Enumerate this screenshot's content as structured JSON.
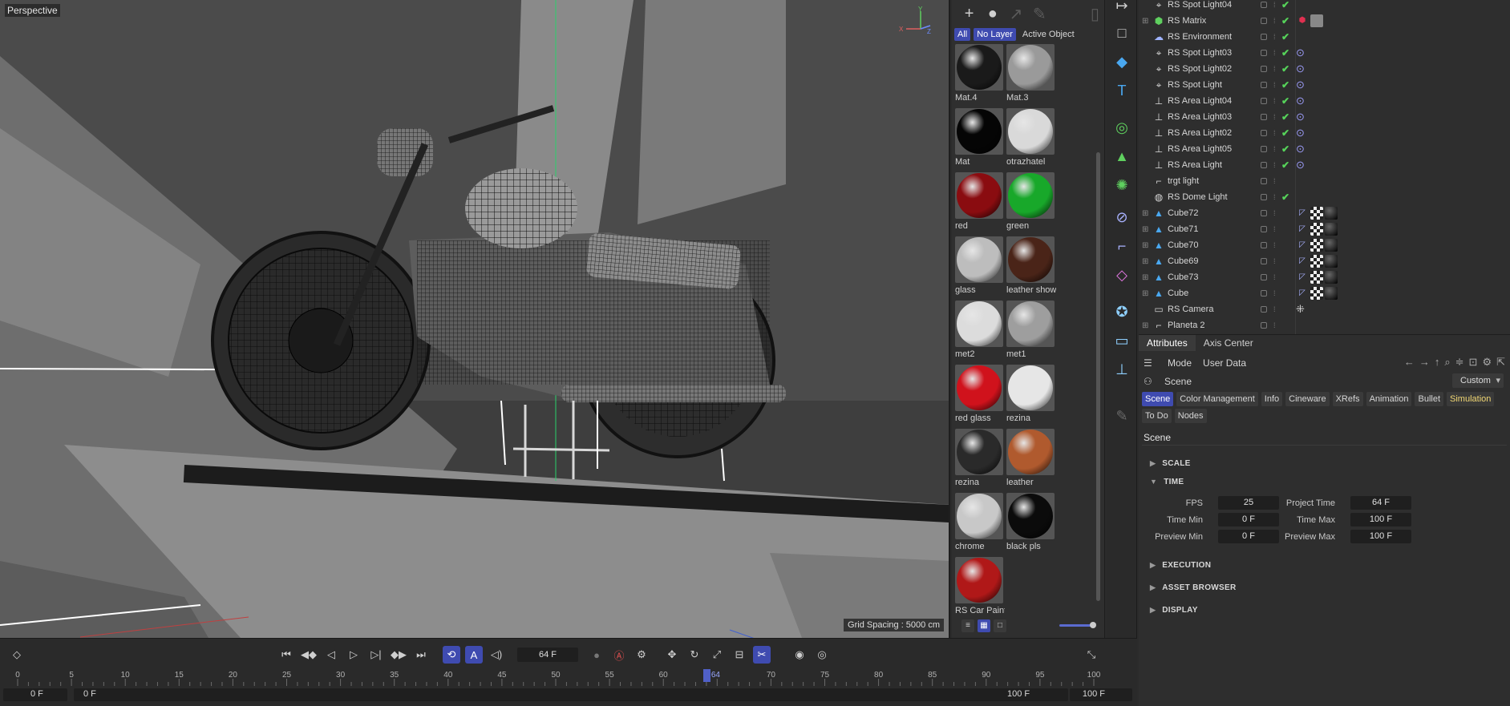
{
  "viewport": {
    "title": "Perspective",
    "grid_spacing": "Grid Spacing : 5000 cm",
    "axes": {
      "x": "X",
      "y": "Y",
      "z": "Z"
    }
  },
  "material_manager": {
    "filters": [
      {
        "label": "All",
        "active": true
      },
      {
        "label": "No Layer",
        "active": true
      },
      {
        "label": "Active Object",
        "active": false
      }
    ],
    "materials": [
      {
        "name": "Mat.4",
        "color": "#1a1a1a"
      },
      {
        "name": "Mat.3",
        "color": "#9a9a9a"
      },
      {
        "name": "Mat",
        "color": "#050505"
      },
      {
        "name": "otrazhatel",
        "color": "#d9d9d9"
      },
      {
        "name": "red",
        "color": "#8a0c10"
      },
      {
        "name": "green",
        "color": "#18a82a"
      },
      {
        "name": "glass",
        "color": "#bdbdbd"
      },
      {
        "name": "leather show",
        "color": "#4a2418"
      },
      {
        "name": "met2",
        "color": "#dcdcdc"
      },
      {
        "name": "met1",
        "color": "#9e9e9e"
      },
      {
        "name": "red glass",
        "color": "#d0121c"
      },
      {
        "name": "rezina",
        "color": "#e6e6e6"
      },
      {
        "name": "rezina",
        "color": "#2a2a2a"
      },
      {
        "name": "leather",
        "color": "#b05a2e"
      },
      {
        "name": "chrome",
        "color": "#c8c8c8"
      },
      {
        "name": "black pls",
        "color": "#0b0b0b"
      },
      {
        "name": "RS Car Paint",
        "color": "#b01818"
      }
    ]
  },
  "object_manager": {
    "rows": [
      {
        "name": "RS Spot Light04",
        "icon": "spot-light-icon",
        "expand": "",
        "check": true,
        "tag": ""
      },
      {
        "name": "RS Matrix",
        "icon": "matrix-icon",
        "expand": "+",
        "check": true,
        "tag": "matrix"
      },
      {
        "name": "RS Environment",
        "icon": "environment-icon",
        "expand": "",
        "check": true,
        "tag": ""
      },
      {
        "name": "RS Spot Light03",
        "icon": "spot-light-icon",
        "expand": "",
        "check": true,
        "tag": "target"
      },
      {
        "name": "RS Spot Light02",
        "icon": "spot-light-icon",
        "expand": "",
        "check": true,
        "tag": "target"
      },
      {
        "name": "RS Spot Light",
        "icon": "spot-light-icon",
        "expand": "",
        "check": true,
        "tag": "target"
      },
      {
        "name": "RS Area Light04",
        "icon": "area-light-icon",
        "expand": "",
        "check": true,
        "tag": "target"
      },
      {
        "name": "RS Area Light03",
        "icon": "area-light-icon",
        "expand": "",
        "check": true,
        "tag": "target"
      },
      {
        "name": "RS Area Light02",
        "icon": "area-light-icon",
        "expand": "",
        "check": true,
        "tag": "target"
      },
      {
        "name": "RS Area Light05",
        "icon": "area-light-icon",
        "expand": "",
        "check": true,
        "tag": "target"
      },
      {
        "name": "RS Area Light",
        "icon": "area-light-icon",
        "expand": "",
        "check": true,
        "tag": "target"
      },
      {
        "name": "trgt light",
        "icon": "null-icon",
        "expand": "",
        "check": false,
        "tag": ""
      },
      {
        "name": "RS Dome Light",
        "icon": "dome-light-icon",
        "expand": "",
        "check": true,
        "tag": ""
      },
      {
        "name": "Cube72",
        "icon": "cube-icon",
        "expand": "+",
        "check": false,
        "tag": "mat"
      },
      {
        "name": "Cube71",
        "icon": "cube-icon",
        "expand": "+",
        "check": false,
        "tag": "mat"
      },
      {
        "name": "Cube70",
        "icon": "cube-icon",
        "expand": "+",
        "check": false,
        "tag": "mat"
      },
      {
        "name": "Cube69",
        "icon": "cube-icon",
        "expand": "+",
        "check": false,
        "tag": "mat"
      },
      {
        "name": "Cube73",
        "icon": "cube-icon",
        "expand": "+",
        "check": false,
        "tag": "mat"
      },
      {
        "name": "Cube",
        "icon": "cube-icon",
        "expand": "+",
        "check": false,
        "tag": "mat"
      },
      {
        "name": "RS Camera",
        "icon": "camera-icon",
        "expand": "",
        "check": false,
        "tag": "camera"
      },
      {
        "name": "Planeta 2",
        "icon": "null-icon",
        "expand": "+",
        "check": false,
        "tag": ""
      }
    ]
  },
  "attributes": {
    "tabs": [
      {
        "label": "Attributes",
        "active": true
      },
      {
        "label": "Axis Center",
        "active": false
      }
    ],
    "menu": {
      "mode": "Mode",
      "user_data": "User Data"
    },
    "scene_label": "Scene",
    "preset": "Custom",
    "group_tabs": [
      {
        "label": "Scene",
        "state": "active"
      },
      {
        "label": "Color Management",
        "state": ""
      },
      {
        "label": "Info",
        "state": ""
      },
      {
        "label": "Cineware",
        "state": ""
      },
      {
        "label": "XRefs",
        "state": ""
      },
      {
        "label": "Animation",
        "state": ""
      },
      {
        "label": "Bullet",
        "state": ""
      },
      {
        "label": "Simulation",
        "state": "hl"
      },
      {
        "label": "To Do",
        "state": ""
      },
      {
        "label": "Nodes",
        "state": ""
      }
    ],
    "heading": "Scene",
    "sections": {
      "scale": "SCALE",
      "time": "TIME",
      "execution": "EXECUTION",
      "asset_browser": "ASSET BROWSER",
      "display": "DISPLAY"
    },
    "fields": {
      "fps_label": "FPS",
      "fps": "25",
      "project_time_label": "Project Time",
      "project_time": "64 F",
      "time_min_label": "Time Min",
      "time_min": "0 F",
      "time_max_label": "Time Max",
      "time_max": "100 F",
      "preview_min_label": "Preview Min",
      "preview_min": "0 F",
      "preview_max_label": "Preview Max",
      "preview_max": "100 F"
    }
  },
  "timeline": {
    "current_frame": "64 F",
    "ticks": [
      "0",
      "5",
      "10",
      "15",
      "20",
      "25",
      "30",
      "35",
      "40",
      "45",
      "50",
      "55",
      "60",
      "64",
      "70",
      "75",
      "80",
      "85",
      "90",
      "95",
      "100"
    ],
    "playhead_label": "64",
    "min": "0 F",
    "range_start": "0 F",
    "range_end": "100 F",
    "max": "100 F"
  }
}
